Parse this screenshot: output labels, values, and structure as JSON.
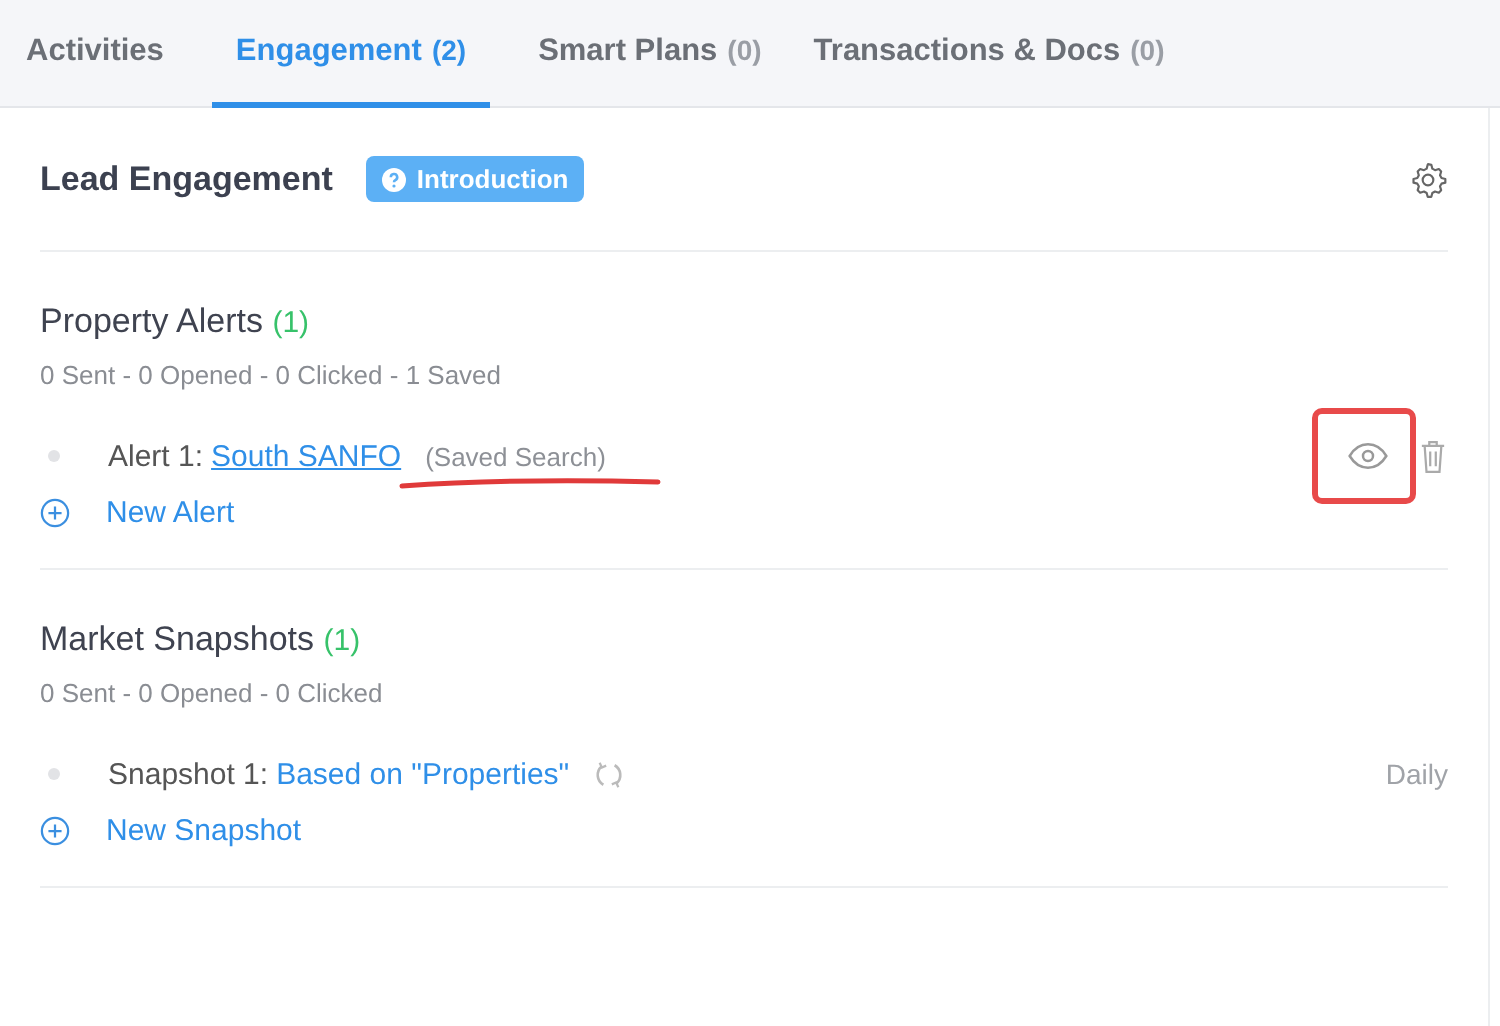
{
  "tabs": [
    {
      "label": "Activities",
      "selected": false
    },
    {
      "label": "Engagement",
      "count": "(2)",
      "selected": true
    },
    {
      "label": "Smart Plans",
      "count": "(0)",
      "selected": false
    },
    {
      "label": "Transactions & Docs",
      "count": "(0)",
      "selected": false
    }
  ],
  "header": {
    "title": "Lead Engagement",
    "badge": "Introduction"
  },
  "sections": [
    {
      "title": "Property Alerts",
      "count": "(1)",
      "stats": "0 Sent - 0 Opened - 0 Clicked - 1 Saved",
      "items": [
        {
          "kind": "alert",
          "label": "Alert 1:",
          "link": "South SANFO",
          "tag": "(Saved Search)",
          "underlined": true,
          "boxed": true
        }
      ],
      "add_label": "New Alert"
    },
    {
      "title": "Market Snapshots",
      "count": "(1)",
      "stats": "0 Sent - 0 Opened - 0 Clicked",
      "items": [
        {
          "kind": "snapshot",
          "label": "Snapshot 1:",
          "link": "Based on \"Properties\"",
          "frequency": "Daily"
        }
      ],
      "add_label": "New Snapshot"
    }
  ]
}
